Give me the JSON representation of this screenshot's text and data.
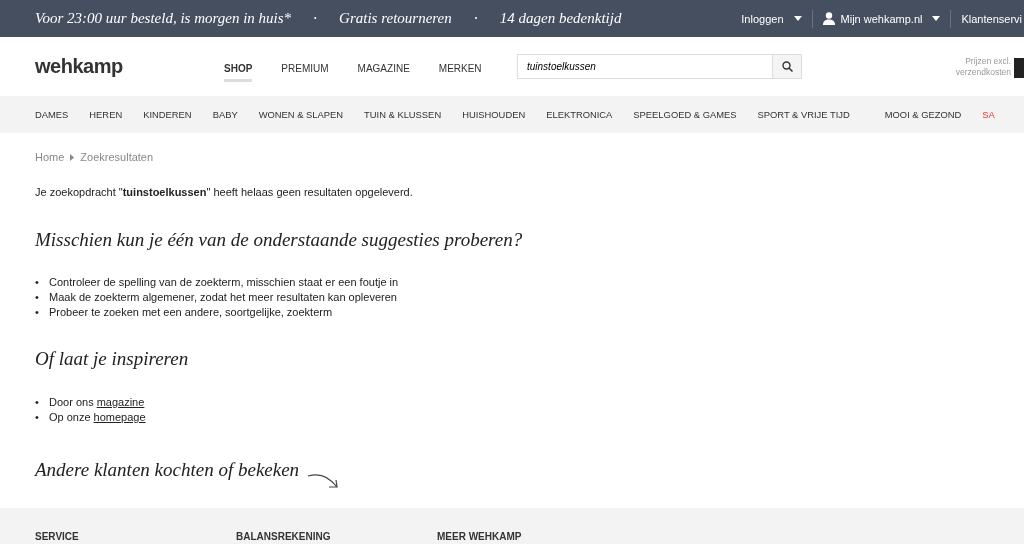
{
  "promo_bar": {
    "items": [
      "Voor 23:00 uur besteld, is morgen in huis*",
      "Gratis retourneren",
      "14 dagen bedenktijd"
    ],
    "separator": "·",
    "account_links": [
      {
        "label": "Inloggen",
        "kind": "menu"
      },
      {
        "label": "Mijn wehkamp.nl",
        "kind": "account"
      },
      {
        "label": "Klantenservi",
        "kind": "plain"
      }
    ]
  },
  "header": {
    "logo": "wehkamp",
    "tabs": [
      {
        "label": "SHOP",
        "selected": true
      },
      {
        "label": "PREMIUM",
        "selected": false
      },
      {
        "label": "MAGAZINE",
        "selected": false
      },
      {
        "label": "MERKEN",
        "selected": false
      }
    ],
    "search": {
      "value": "tuinstoelkussen"
    },
    "price_note": "Prijzen excl. verzendkosten"
  },
  "categories": [
    {
      "label": "DAMES",
      "kind": "normal"
    },
    {
      "label": "HEREN",
      "kind": "normal"
    },
    {
      "label": "KINDEREN",
      "kind": "normal"
    },
    {
      "label": "BABY",
      "kind": "normal"
    },
    {
      "label": "WONEN & SLAPEN",
      "kind": "normal"
    },
    {
      "label": "TUIN & KLUSSEN",
      "kind": "normal"
    },
    {
      "label": "HUISHOUDEN",
      "kind": "normal"
    },
    {
      "label": "ELEKTRONICA",
      "kind": "normal"
    },
    {
      "label": "SPEELGOED & GAMES",
      "kind": "normal"
    },
    {
      "label": "SPORT & VRIJE TIJD",
      "kind": "normal"
    },
    {
      "label": "MOOI & GEZOND",
      "kind": "normal"
    },
    {
      "label": "SA",
      "kind": "sale"
    }
  ],
  "bullet": "•",
  "breadcrumb": [
    "Home",
    "Zoekresultaten"
  ],
  "message": "Je zoekopdracht \"**tuinstoelkussen**\" heeft helaas geen resultaten opgeleverd.",
  "suggestions": {
    "heading": "Misschien kun je één van de onderstaande suggesties proberen?",
    "items": [
      "Controleer de spelling van de zoekterm, misschien staat er een foutje in",
      "Maak de zoekterm algemener, zodat het meer resultaten kan opleveren",
      "Probeer te zoeken met een andere, soortgelijke, zoekterm"
    ]
  },
  "inspiration": {
    "heading": "Of laat je inspireren",
    "items": [
      {
        "text": "Door ons ",
        "link": "magazine"
      },
      {
        "text": "Op onze ",
        "link": "homepage"
      }
    ]
  },
  "others_heading": "Andere klanten kochten of bekeken",
  "footer": {
    "columns": [
      "SERVICE",
      "BALANSREKENING",
      "MEER WEHKAMP"
    ]
  }
}
